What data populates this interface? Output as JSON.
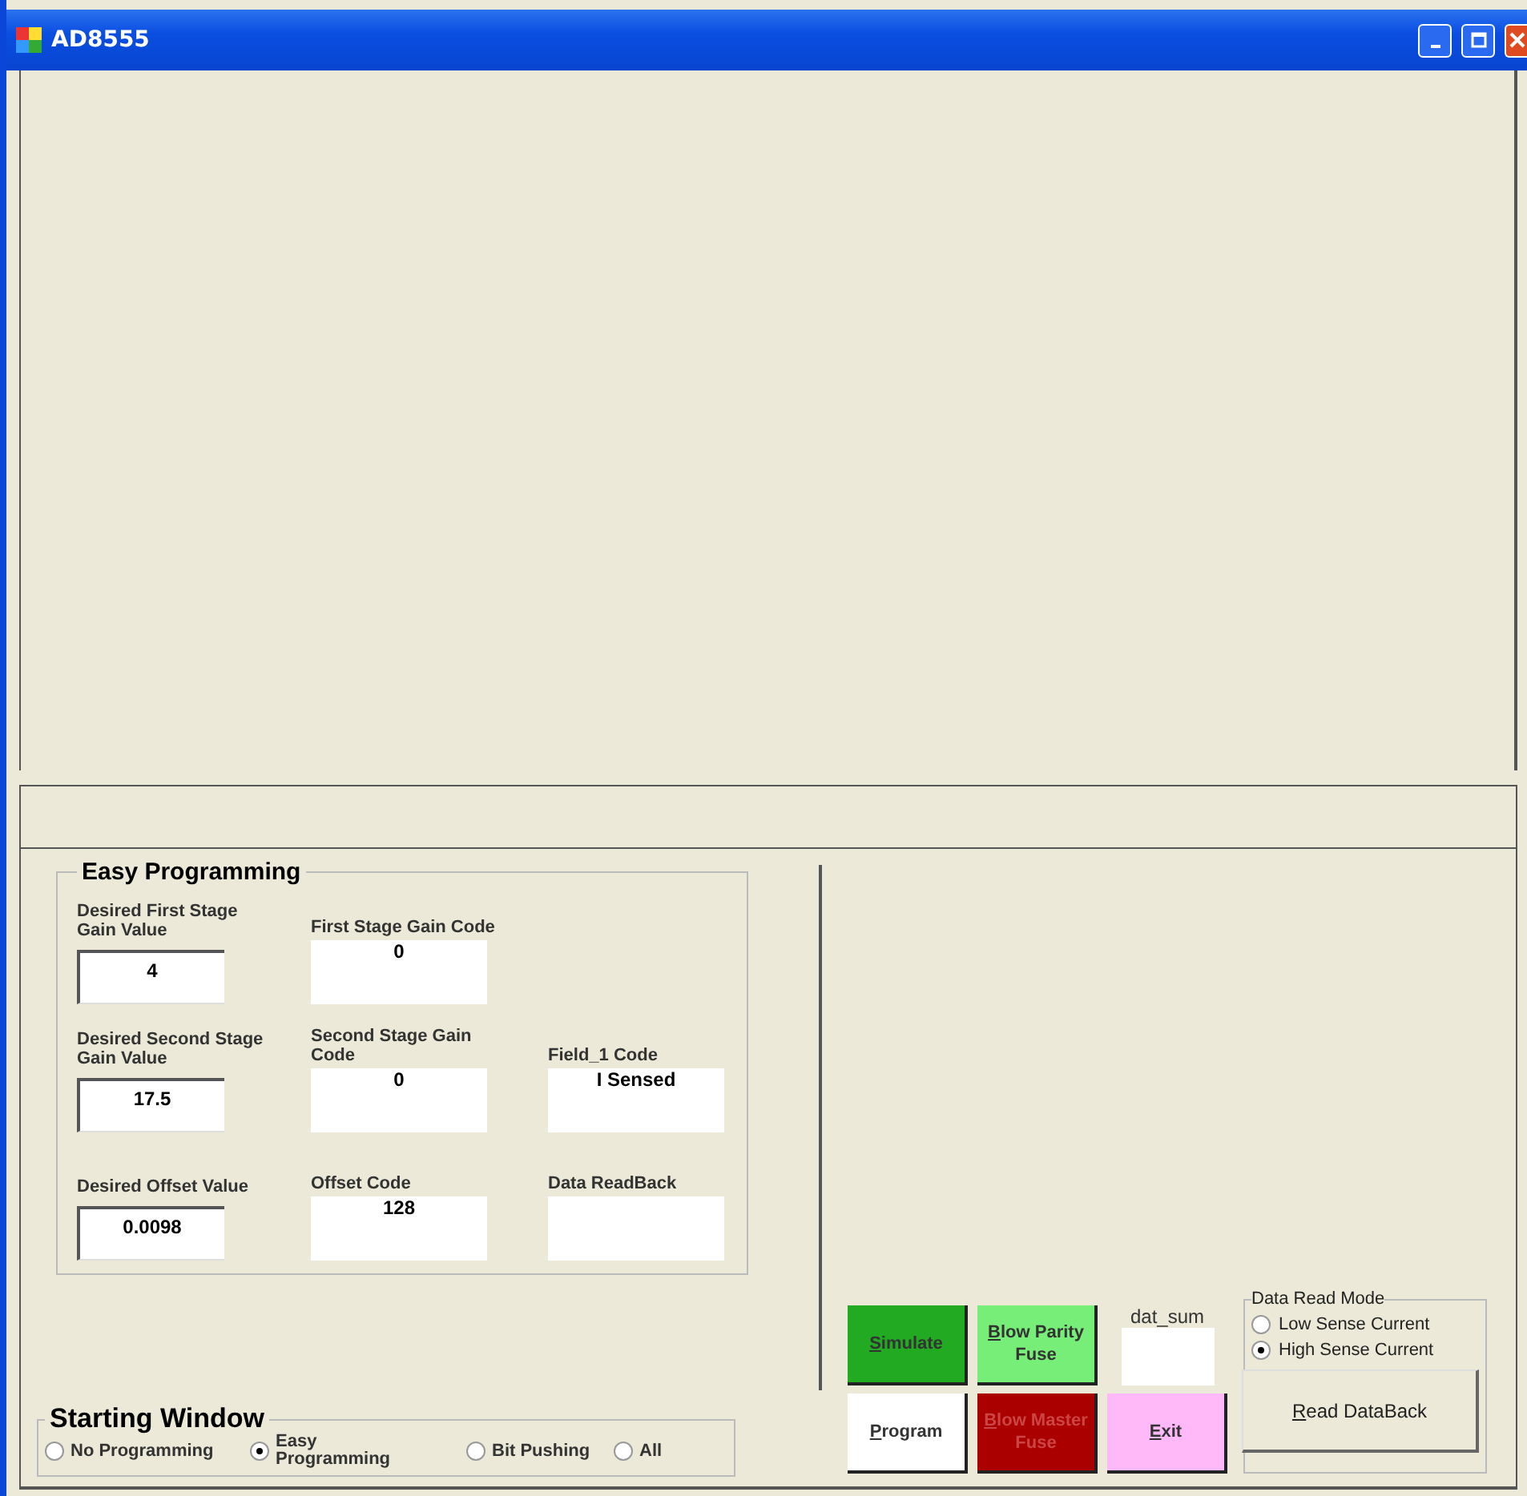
{
  "window": {
    "title": "AD8555"
  },
  "easy_programming": {
    "title": "Easy Programming",
    "fields": [
      {
        "label": "Desired First Stage Gain Value",
        "value": "4",
        "kind": "input"
      },
      {
        "label": "First Stage Gain Code",
        "value": "0",
        "kind": "output"
      },
      {
        "kind": "empty"
      },
      {
        "label": "Desired Second Stage Gain Value",
        "value": "17.5",
        "kind": "input"
      },
      {
        "label": "Second Stage Gain Code",
        "value": "0",
        "kind": "output"
      },
      {
        "label": "Field_1 Code",
        "value": "I Sensed",
        "kind": "output"
      },
      {
        "label": "Desired Offset Value",
        "value": "0.0098",
        "kind": "input"
      },
      {
        "label": "Offset Code",
        "value": "128",
        "kind": "output"
      },
      {
        "label": "Data ReadBack",
        "kind": "output"
      }
    ]
  },
  "starting_window": {
    "title": "Starting Window",
    "options": [
      {
        "label": "No Programming",
        "selected": false
      },
      {
        "label": "Easy Programming",
        "selected": true
      },
      {
        "label": "Bit Pushing",
        "selected": false
      },
      {
        "label": "All",
        "selected": false
      }
    ]
  },
  "buttons": [
    {
      "label": "Simulate",
      "color": "#22aa22"
    },
    {
      "label": "Blow Parity Fuse",
      "color": "#77ee77"
    },
    {
      "label": "Program",
      "color": "#ffffff"
    },
    {
      "label": "Blow Master Fuse",
      "color": "#aa0000"
    },
    {
      "label": "Exit",
      "color": "#ffb8f8"
    }
  ],
  "dat_sum": {
    "label": "dat_sum"
  },
  "data_read_mode": {
    "title": "Data Read Mode",
    "options": [
      {
        "label": "Low Sense Current",
        "selected": false
      },
      {
        "label": "High Sense Current",
        "selected": true
      }
    ],
    "button": "Read DataBack"
  }
}
